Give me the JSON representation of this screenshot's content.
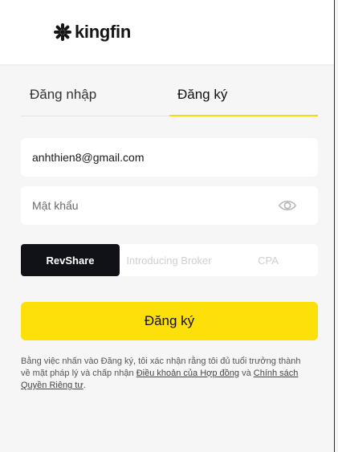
{
  "brand": {
    "name": "kingfin"
  },
  "tabs": [
    {
      "label": "Đăng nhập",
      "active": false
    },
    {
      "label": "Đăng ký",
      "active": true
    }
  ],
  "form": {
    "email": {
      "value": "anhthien8@gmail.com",
      "placeholder": ""
    },
    "password": {
      "value": "",
      "placeholder": "Mật khẩu",
      "toggle_icon": "eye-icon"
    }
  },
  "program_options": [
    {
      "label": "RevShare",
      "selected": true
    },
    {
      "label": "Introducing Broker",
      "selected": false
    },
    {
      "label": "CPA",
      "selected": false
    }
  ],
  "submit_label": "Đăng ký",
  "terms": {
    "prefix": "Bằng việc nhấn vào Đăng ký, tôi xác nhận rằng tôi đủ tuổi trưởng thành về mặt pháp lý và chấp nhận ",
    "contract_link": "Điều khoản của Hợp đồng",
    "middle": " và ",
    "privacy_link": "Chính sách Quyền Riêng tư",
    "suffix": "."
  },
  "colors": {
    "accent": "#fde00a",
    "selected_segment": "#111217",
    "background": "#f6f6f6"
  }
}
